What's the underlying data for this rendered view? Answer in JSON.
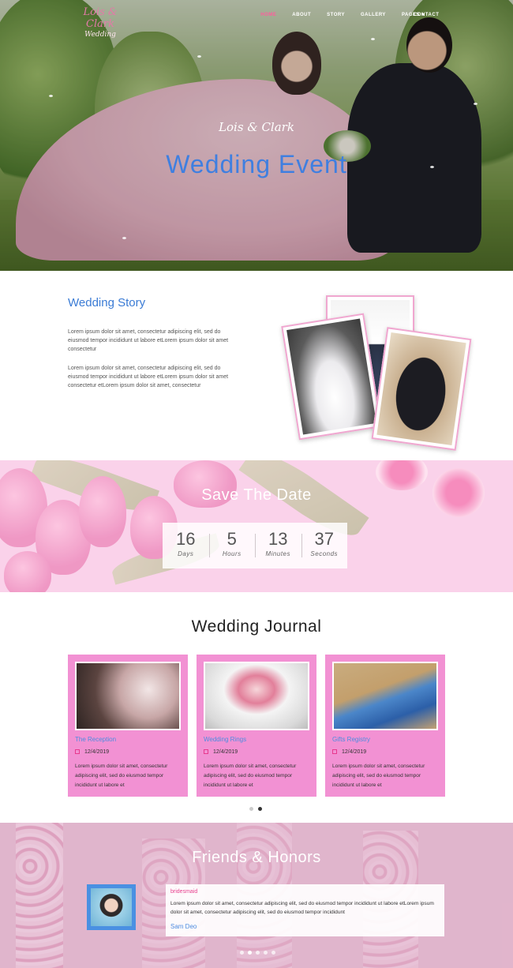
{
  "nav": {
    "logo_title": "Lois & Clark",
    "logo_sub": "Wedding",
    "items": [
      "HOME",
      "ABOUT",
      "STORY",
      "GALLERY",
      "PAGES",
      "CONTACT"
    ],
    "active_index": 0
  },
  "hero": {
    "subtitle": "Lois & Clark",
    "title": "Wedding Event"
  },
  "story": {
    "heading": "Wedding Story",
    "paragraph1": "Lorem ipsum dolor sit amet, consectetur adipiscing elit, sed do eiusmod tempor incididunt ut labore etLorem ipsum dolor sit amet consectetur",
    "paragraph2": "Lorem ipsum dolor sit amet, consectetur adipiscing elit, sed do eiusmod tempor incididunt ut labore etLorem ipsum dolor sit amet consectetur etLorem ipsum dolor sit amet, consectetur"
  },
  "save_the_date": {
    "heading": "Save The Date",
    "countdown": [
      {
        "value": "16",
        "label": "Days"
      },
      {
        "value": "5",
        "label": "Hours"
      },
      {
        "value": "13",
        "label": "Minutes"
      },
      {
        "value": "37",
        "label": "Seconds"
      }
    ]
  },
  "journal": {
    "heading": "Wedding Journal",
    "cards": [
      {
        "title": "The Reception",
        "date": "12/4/2019",
        "text": "Lorem ipsum dolor sit amet, consectetur adipiscing elit, sed do eiusmod tempor incididunt ut labore et"
      },
      {
        "title": "Wedding Rings",
        "date": "12/4/2019",
        "text": "Lorem ipsum dolor sit amet, consectetur adipiscing elit, sed do eiusmod tempor incididunt ut labore et"
      },
      {
        "title": "Gifts Registry",
        "date": "12/4/2019",
        "text": "Lorem ipsum dolor sit amet, consectetur adipiscing elit, sed do eiusmod tempor incididunt ut labore et"
      }
    ],
    "slider_dots": 2,
    "active_dot": 1
  },
  "friends": {
    "heading": "Friends & Honors",
    "role": "bridesmaid",
    "quote": "Lorem ipsum dolor sit amet, consectetur adipiscing elit, sed do eiusmod tempor incididunt ut labore etLorem ipsum dolor sit amet, consectetur adipiscing elit, sed do eiusmod tempor incididunt",
    "name": "Sam Deo",
    "slider_dots": 5,
    "active_dot": 1
  },
  "colors": {
    "accent_pink": "#f291d3",
    "link_blue": "#4d8ce0",
    "nav_active": "#ff5c9d"
  }
}
